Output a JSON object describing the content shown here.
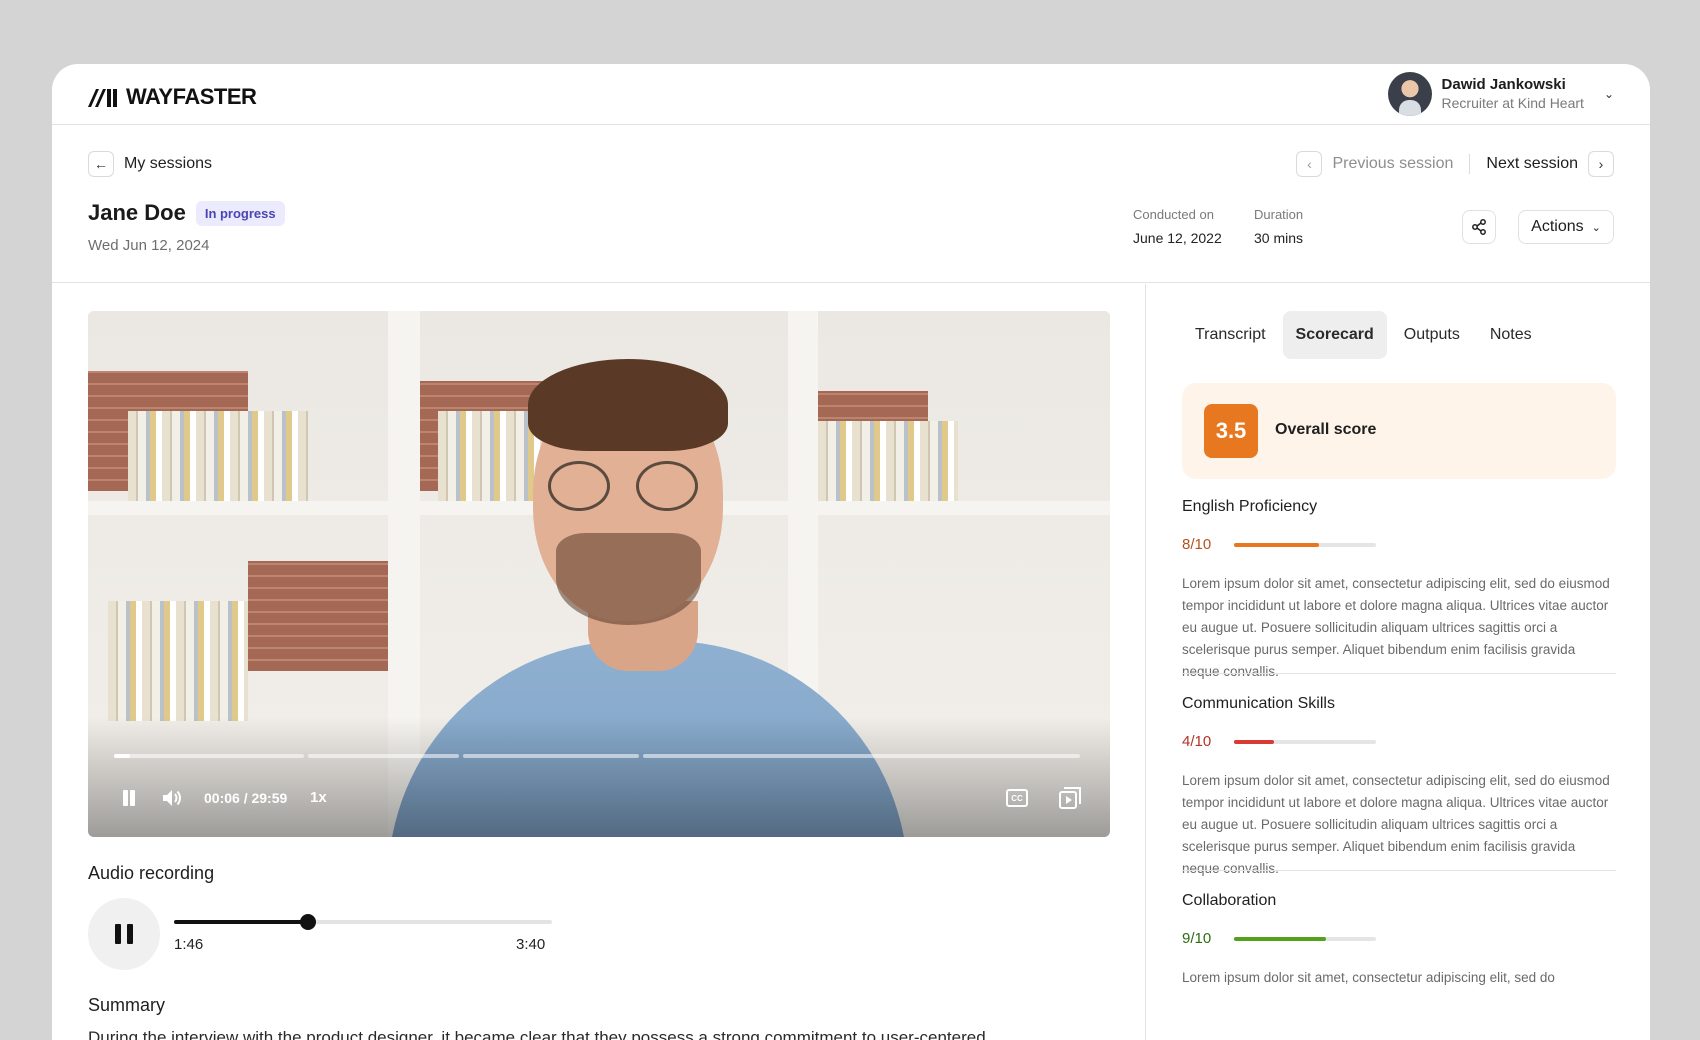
{
  "brand": {
    "name": "WAYFASTER"
  },
  "user": {
    "name": "Dawid Jankowski",
    "role": "Recruiter at Kind Heart"
  },
  "nav": {
    "back_label": "My sessions",
    "prev_label": "Previous session",
    "next_label": "Next session"
  },
  "candidate": {
    "name": "Jane Doe",
    "status": "In progress",
    "date": "Wed Jun 12, 2024"
  },
  "meta": {
    "conducted_label": "Conducted on",
    "conducted_value": "June 12, 2022",
    "duration_label": "Duration",
    "duration_value": "30 mins"
  },
  "actions_label": "Actions",
  "video": {
    "time": "00:06 / 29:59",
    "speed": "1x",
    "progress": 0.016,
    "chapters": [
      0.2,
      0.36,
      0.545,
      1.0
    ]
  },
  "audio": {
    "title": "Audio recording",
    "current": "1:46",
    "total": "3:40",
    "progress": 0.355
  },
  "summary": {
    "title": "Summary",
    "text": "During the interview with the product designer, it became clear that they possess a strong commitment to user-centered"
  },
  "tabs": [
    {
      "label": "Transcript",
      "active": false
    },
    {
      "label": "Scorecard",
      "active": true
    },
    {
      "label": "Outputs",
      "active": false
    },
    {
      "label": "Notes",
      "active": false
    }
  ],
  "overall": {
    "score": "3.5",
    "label": "Overall score"
  },
  "skills": [
    {
      "name": "English Proficiency",
      "score": "8/10",
      "value": 0.6,
      "color": "#e8781f",
      "score_color": "#b4531b",
      "desc": "Lorem ipsum dolor sit amet, consectetur adipiscing elit, sed do eiusmod tempor incididunt ut labore et dolore magna aliqua. Ultrices vitae auctor eu augue ut. Posuere sollicitudin aliquam ultrices sagittis orci a scelerisque purus semper. Aliquet bibendum enim facilisis gravida neque convallis."
    },
    {
      "name": "Communication Skills",
      "score": "4/10",
      "value": 0.28,
      "color": "#d93a32",
      "score_color": "#b43228",
      "desc": "Lorem ipsum dolor sit amet, consectetur adipiscing elit, sed do eiusmod tempor incididunt ut labore et dolore magna aliqua. Ultrices vitae auctor eu augue ut. Posuere sollicitudin aliquam ultrices sagittis orci a scelerisque purus semper. Aliquet bibendum enim facilisis gravida neque convallis."
    },
    {
      "name": "Collaboration",
      "score": "9/10",
      "value": 0.65,
      "color": "#55a11b",
      "score_color": "#2f6b12",
      "desc": "Lorem ipsum dolor sit amet, consectetur adipiscing elit, sed do"
    }
  ]
}
